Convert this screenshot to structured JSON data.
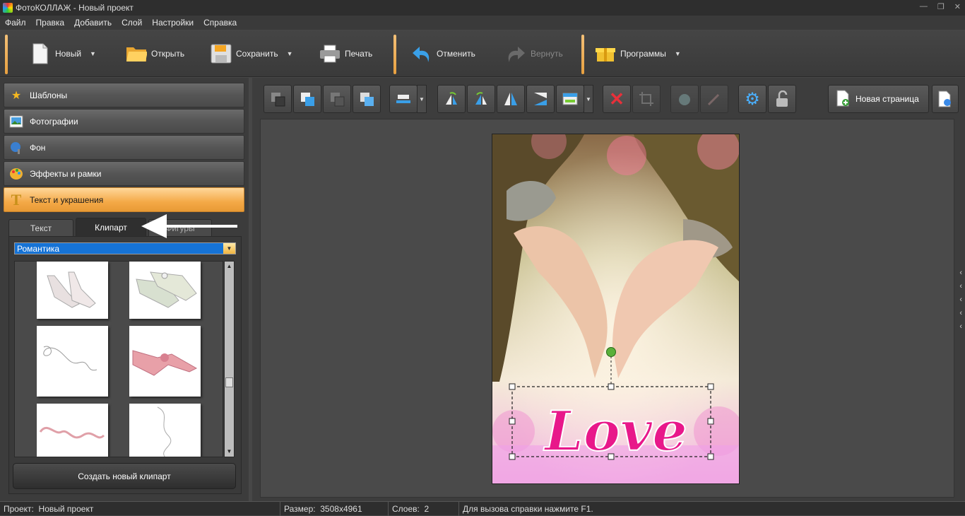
{
  "window": {
    "title": "ФотоКОЛЛАЖ - Новый проект"
  },
  "menu": [
    "Файл",
    "Правка",
    "Добавить",
    "Слой",
    "Настройки",
    "Справка"
  ],
  "toolbar": {
    "new": "Новый",
    "open": "Открыть",
    "save": "Сохранить",
    "print": "Печать",
    "undo": "Отменить",
    "redo": "Вернуть",
    "programs": "Программы"
  },
  "sidebar": {
    "sections": [
      "Шаблоны",
      "Фотографии",
      "Фон",
      "Эффекты и рамки",
      "Текст и украшения"
    ]
  },
  "tabs": {
    "text": "Текст",
    "clipart": "Клипарт",
    "shapes": "Фигуры"
  },
  "clipart": {
    "category": "Романтика",
    "create_button": "Создать новый клипарт"
  },
  "work": {
    "new_page": "Новая страница",
    "love_text": "Love"
  },
  "status": {
    "project_label": "Проект:",
    "project": "Новый проект",
    "size_label": "Размер:",
    "size": "3508x4961",
    "layers_label": "Слоев:",
    "layers": "2",
    "hint": "Для вызова справки нажмите F1."
  },
  "colors": {
    "accent": "#f4a947",
    "selection": "#1673d6",
    "love": "#e8188a"
  }
}
